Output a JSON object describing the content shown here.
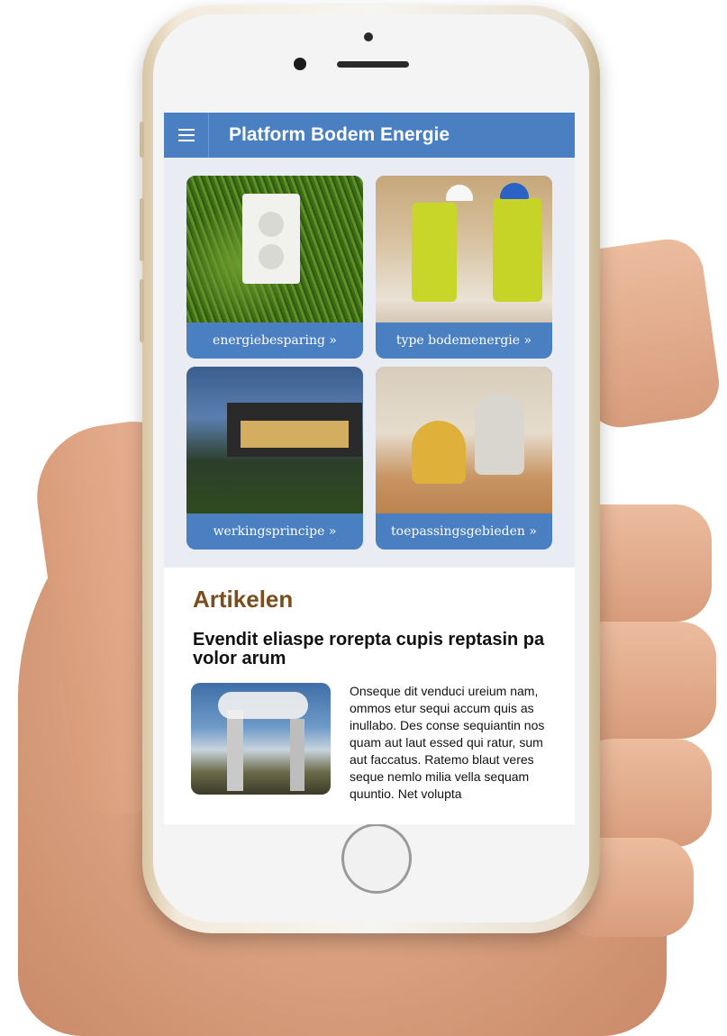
{
  "app": {
    "title": "Platform Bodem Energie"
  },
  "tiles": [
    {
      "label": "energiebesparing »"
    },
    {
      "label": "type bodemenergie »"
    },
    {
      "label": "werkingsprincipe »"
    },
    {
      "label": "toepassingsgebieden »"
    }
  ],
  "articles": {
    "heading": "Artikelen",
    "title": "Evendit eliaspe rorepta cupis reptasin pa volor arum",
    "body": "Onseque dit venduci ureium nam, ommos etur sequi accum quis as inullabo. Des conse sequiantin nos quam aut laut essed qui ratur, sum aut faccatus. Ratemo blaut veres seque nemlo milia vella sequam quuntio. Net volupta"
  },
  "colors": {
    "accent": "#4a7fc1",
    "heading": "#7a4e1e"
  }
}
